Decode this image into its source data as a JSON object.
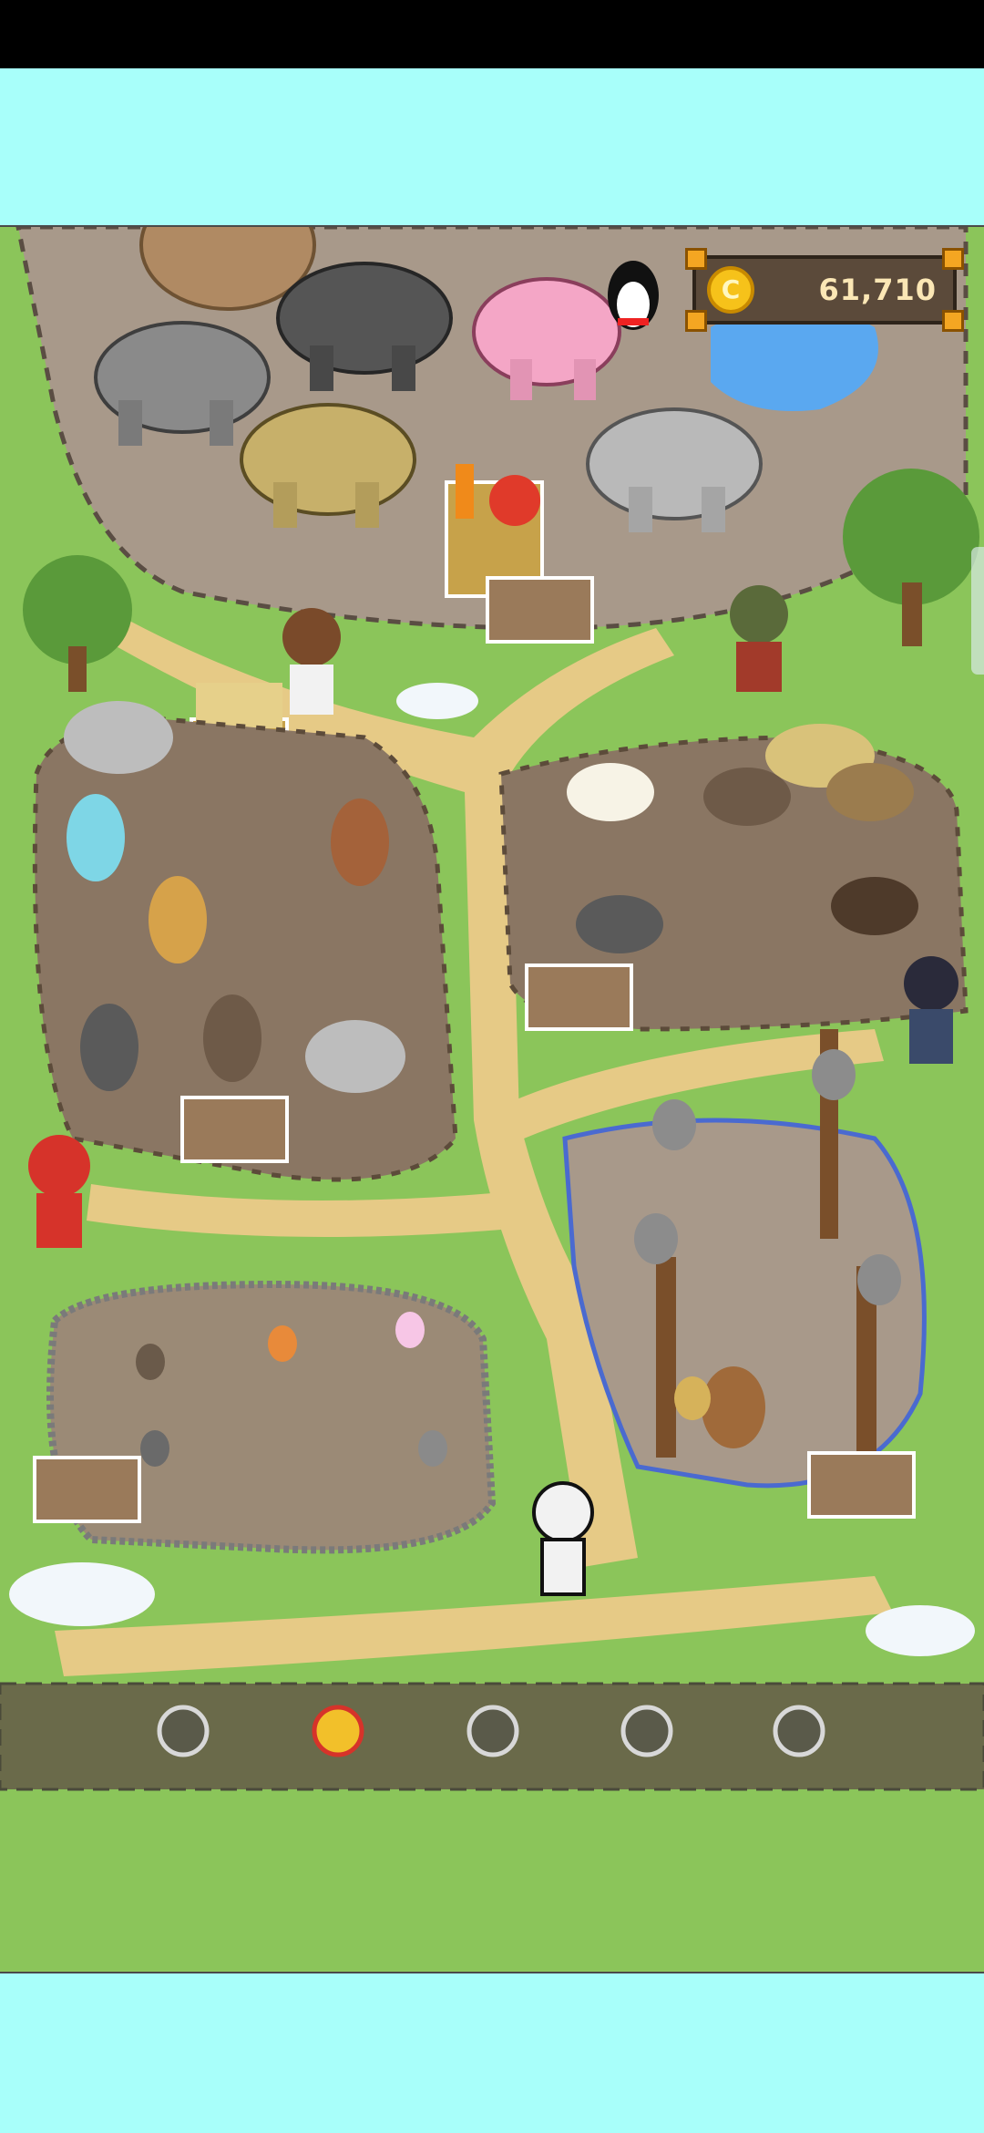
{
  "game": {
    "coins": "61,710",
    "coin_icon": "coin-icon",
    "coin_symbol": "C"
  },
  "enclosures": [
    {
      "name": "elephant-enclosure",
      "animal": "elephant",
      "food": "vegetable-crate"
    },
    {
      "name": "kangaroo-enclosure",
      "animal": "kangaroo",
      "food": "hay-crate"
    },
    {
      "name": "donkey-enclosure",
      "animal": "donkey",
      "food": "hay-crate"
    },
    {
      "name": "koala-enclosure",
      "animal": "koala",
      "food": "leaf-crate"
    },
    {
      "name": "rabbit-enclosure",
      "animal": "rabbit",
      "food": "vegetable-crate"
    }
  ],
  "visitors": [
    "schoolgirl",
    "ninja-visitor",
    "ranger-with-hat",
    "santa-claus",
    "prisoner"
  ],
  "path_slots": {
    "total": 5,
    "active_index": 1
  },
  "colors": {
    "sky": "#a8fffa",
    "grass": "#8bc55a",
    "path": "#e8cd8a",
    "dirt": "#8b7560",
    "coin_gold": "#f6c21a"
  }
}
